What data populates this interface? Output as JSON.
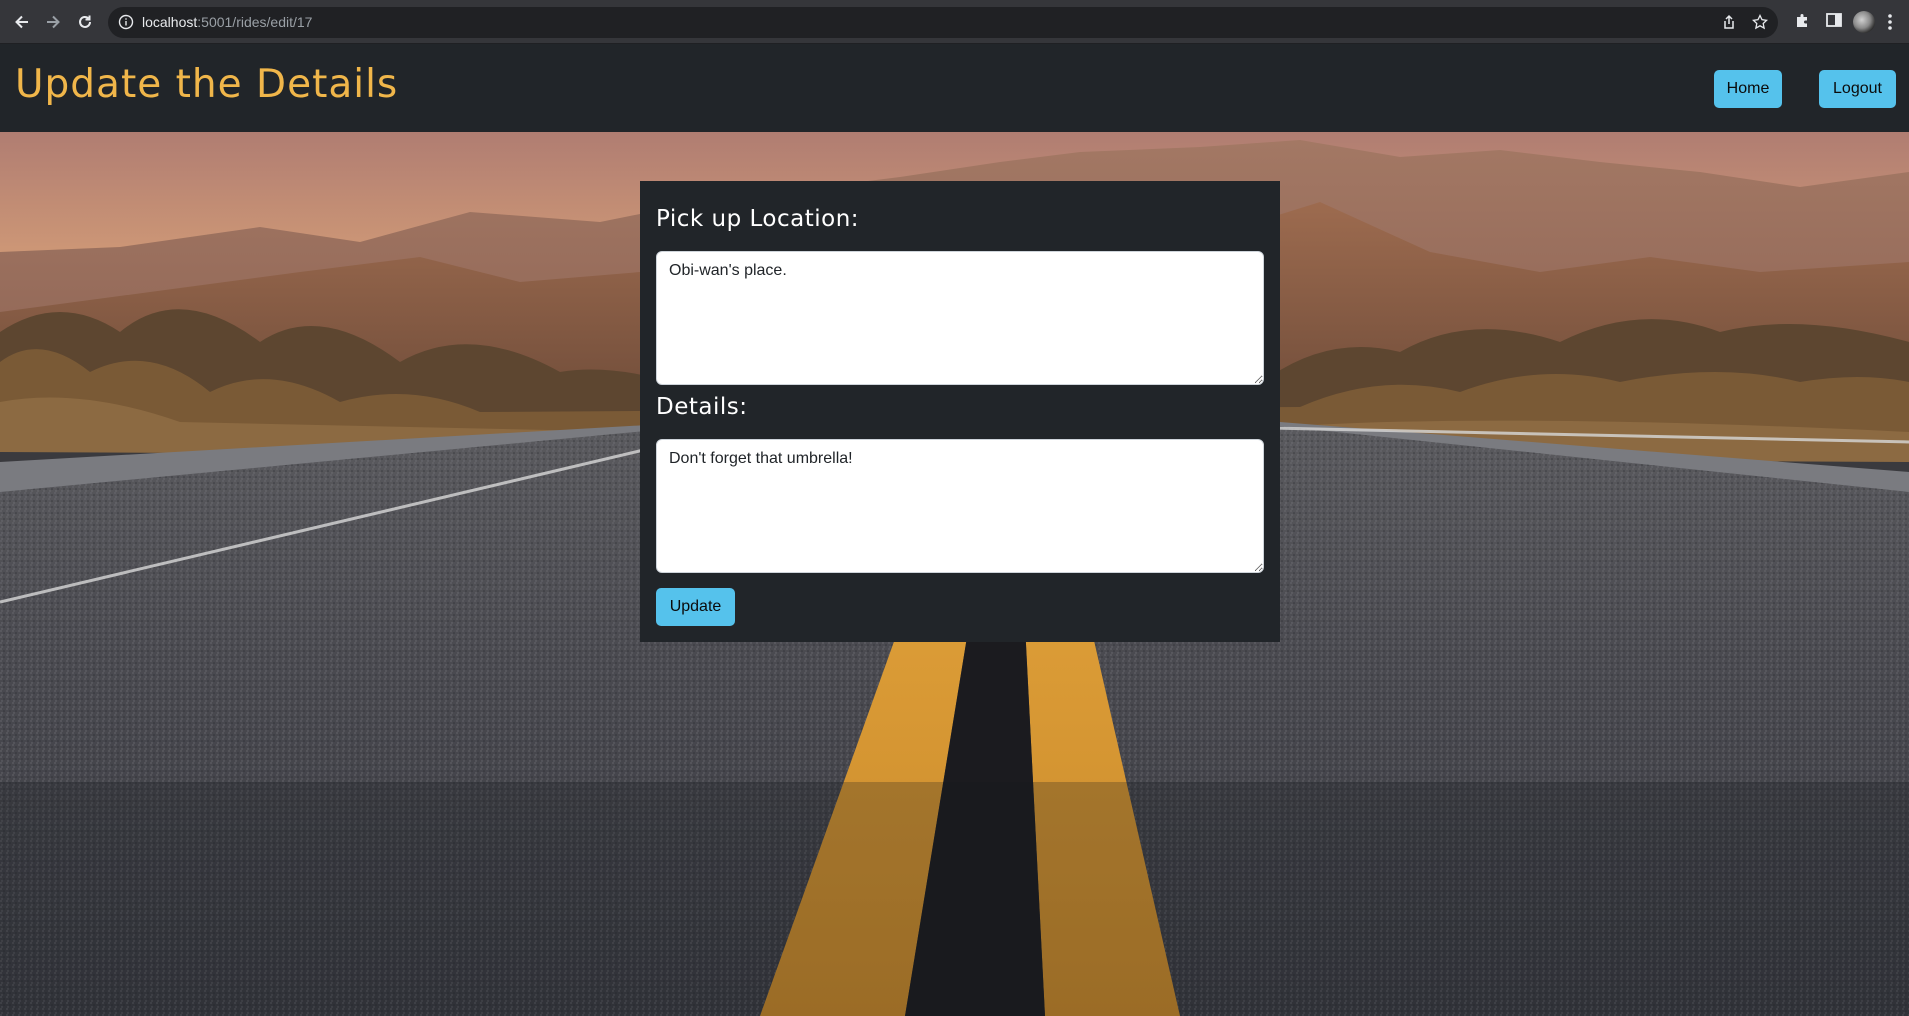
{
  "browser": {
    "url_host": "localhost",
    "url_path": ":5001/rides/edit/17"
  },
  "header": {
    "title": "Update the Details",
    "home_label": "Home",
    "logout_label": "Logout"
  },
  "form": {
    "pickup_label": "Pick up Location:",
    "pickup_value": "Obi-wan's place.",
    "details_label": "Details:",
    "details_value": "Don't forget that umbrella!",
    "submit_label": "Update"
  },
  "colors": {
    "header_bg": "#212529",
    "title": "#f0b64a",
    "button": "#55c2ec",
    "card_bg": "#212529"
  }
}
